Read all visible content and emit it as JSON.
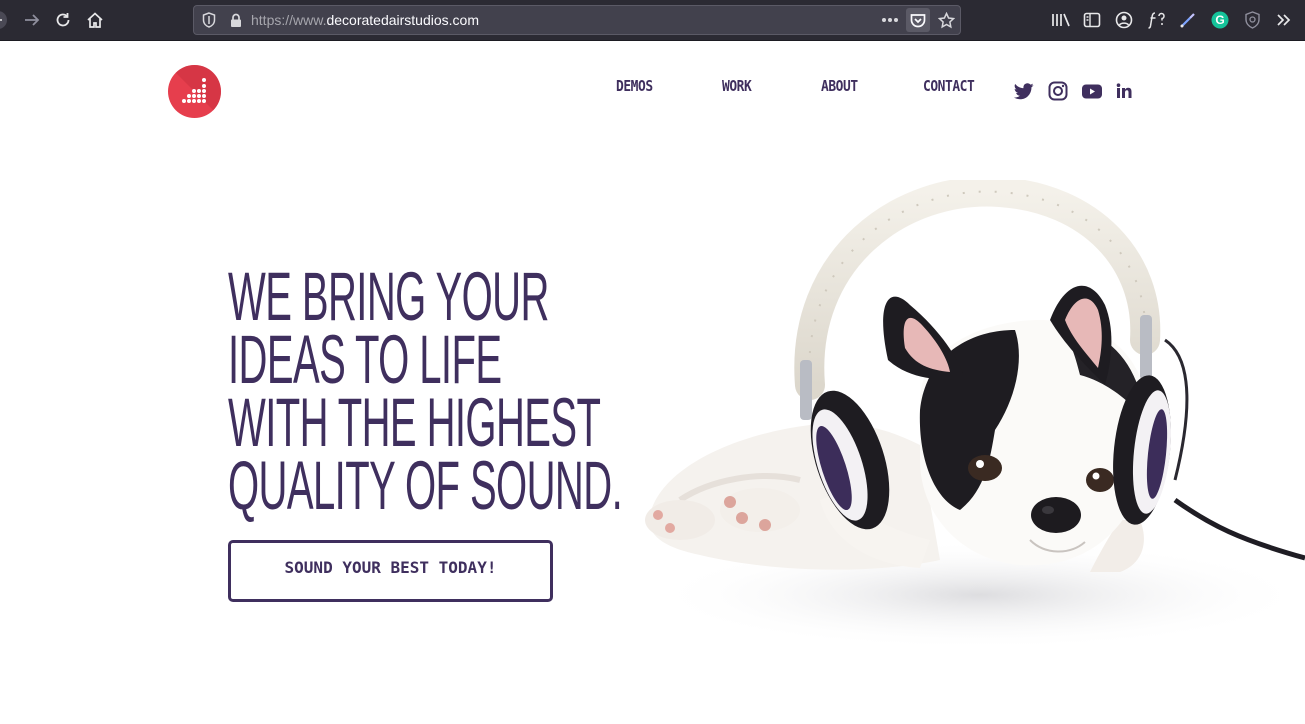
{
  "browser": {
    "url_prefix": "https://www.",
    "url_domain": "decoratedairstudios.com",
    "ext_g_label": "G"
  },
  "nav": {
    "items": [
      {
        "label": "DEMOS"
      },
      {
        "label": "WORK"
      },
      {
        "label": "ABOUT"
      },
      {
        "label": "CONTACT"
      }
    ],
    "social_icons": [
      "twitter-icon",
      "instagram-icon",
      "youtube-icon",
      "linkedin-icon"
    ]
  },
  "hero": {
    "headline_lines": [
      "WE BRING YOUR",
      "IDEAS TO LIFE",
      "WITH THE HIGHEST",
      "QUALITY OF SOUND."
    ],
    "cta_label": "SOUND YOUR BEST TODAY!",
    "image": "french-bulldog-with-headphones"
  },
  "colors": {
    "brand_purple": "#3f2f5e",
    "logo_red": "#e63e4d",
    "chrome_bg": "#2b2a33"
  }
}
